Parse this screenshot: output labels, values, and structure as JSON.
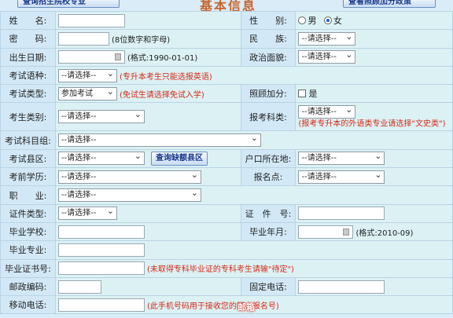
{
  "header": {
    "left_button": "查询招生院校专业",
    "title": "基本信息",
    "right_button": "查看照顾加分政策"
  },
  "fields": {
    "name": {
      "label": "姓　　名:",
      "value": ""
    },
    "gender": {
      "label": "性　　别:",
      "options": [
        "男",
        "女"
      ],
      "selected": "女"
    },
    "password": {
      "label": "密　　码:",
      "value": "",
      "hint": "(8位数字和字母)"
    },
    "ethnicity": {
      "label": "民　　族:",
      "value": "--请选择--"
    },
    "birthdate": {
      "label": "出生日期:",
      "value": "",
      "hint": "(格式:1990-01-01)"
    },
    "political": {
      "label": "政治面貌:",
      "value": "--请选择--"
    },
    "exam_language": {
      "label": "考试语种:",
      "value": "--请选择--",
      "hint": "(专升本考生只能选报英语)"
    },
    "exam_type": {
      "label": "考试类型:",
      "value": "参加考试",
      "hint": "(免试生请选择免试入学)"
    },
    "bonus": {
      "label": "照顾加分:",
      "option": "是"
    },
    "candidate_category": {
      "label": "考生类别:",
      "value": "--请选择--"
    },
    "subject_category": {
      "label": "报考科类:",
      "value": "--请选择--",
      "hint": "(报考专升本的外语类专业请选择\"文史类\")"
    },
    "subject_group": {
      "label": "考试科目组:",
      "value": "--请选择--"
    },
    "exam_county": {
      "label": "考试县区:",
      "value": "--请选择--",
      "button": "查询缺额县区"
    },
    "household": {
      "label": "户口所在地:",
      "value": "--请选择--"
    },
    "pre_education": {
      "label": "考前学历:",
      "value": "--请选择--"
    },
    "exam_site": {
      "label": "报名点:",
      "value": "--请选择--"
    },
    "occupation": {
      "label": "职　　业:",
      "value": "--请选择--"
    },
    "id_type": {
      "label": "证件类型:",
      "value": "--请选择--"
    },
    "id_number": {
      "label": "证　件　号:",
      "value": ""
    },
    "graduate_school": {
      "label": "毕业学校:",
      "value": ""
    },
    "graduate_date": {
      "label": "毕业年月:",
      "value": "",
      "hint": "(格式:2010-09)"
    },
    "graduate_major": {
      "label": "毕业专业:",
      "value": ""
    },
    "certificate_no": {
      "label": "毕业证书号:",
      "value": "",
      "hint": "(未取得专科毕业证的专科考生请输\"待定\")"
    },
    "postcode": {
      "label": "邮政编码:",
      "value": ""
    },
    "landline": {
      "label": "固定电话:",
      "value": ""
    },
    "mobile": {
      "label": "移动电话:",
      "value": "",
      "hint": "(此手机号码用于接收您的网上报名号)"
    }
  },
  "watermark": "邮箱"
}
